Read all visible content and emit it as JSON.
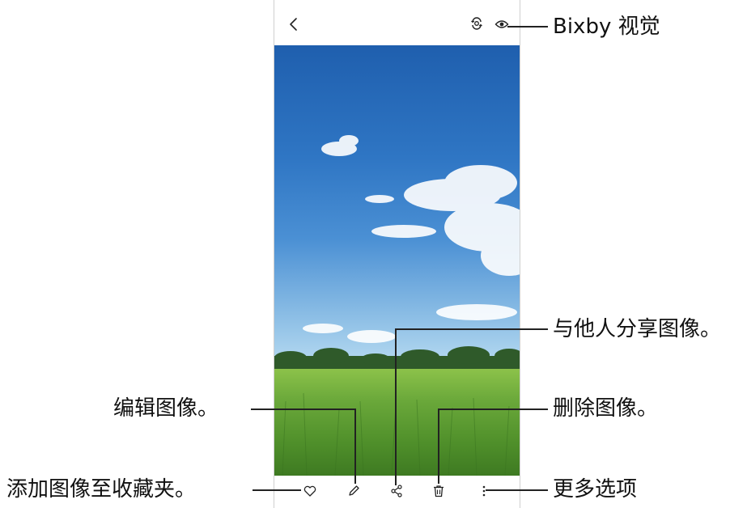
{
  "callouts": {
    "bixby_vision": "Bixby 视觉",
    "share_image": "与他人分享图像。",
    "edit_image": "编辑图像。",
    "delete_image": "删除图像。",
    "add_to_favorites": "添加图像至收藏夹。",
    "more_options": "更多选项"
  },
  "icons": {
    "back": "chevron-left-icon",
    "bixby_vision": "bixby-vision-icon",
    "eye": "eye-icon",
    "favorite": "heart-icon",
    "edit": "pencil-icon",
    "share": "share-icon",
    "delete": "trash-icon",
    "more": "more-vertical-icon"
  },
  "colors": {
    "sky_top": "#1f5fae",
    "sky_mid": "#3f86cf",
    "sky_low": "#9cc9ea",
    "grass": "#5b9a2f",
    "callout_line": "#222222"
  }
}
